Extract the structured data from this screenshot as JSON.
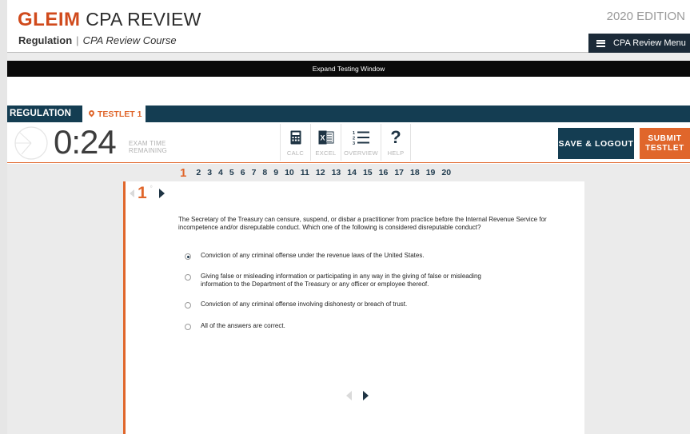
{
  "header": {
    "logo_brand": "GLEIM",
    "logo_rest": " CPA REVIEW",
    "subtitle_section": "Regulation",
    "subtitle_separator": "|",
    "subtitle_course": "CPA Review Course",
    "edition": "2020 EDITION",
    "menu_label": "CPA Review Menu"
  },
  "expand_bar": {
    "label": "Expand Testing Window"
  },
  "tabs": {
    "section": "REGULATION",
    "testlet": "TESTLET 1"
  },
  "toolbar": {
    "timer": "0:24",
    "timer_label_line1": "EXAM TIME",
    "timer_label_line2": "REMAINING",
    "tools": [
      {
        "label": "CALC",
        "icon": "calculator-icon"
      },
      {
        "label": "EXCEL",
        "icon": "excel-icon"
      },
      {
        "label": "OVERVIEW",
        "icon": "overview-list-icon"
      },
      {
        "label": "HELP",
        "icon": "help-icon"
      }
    ],
    "save_label": "SAVE & LOGOUT",
    "submit_line1": "SUBMIT",
    "submit_line2": "TESTLET"
  },
  "question_nav": {
    "current": 1,
    "items": [
      "1",
      "2",
      "3",
      "4",
      "5",
      "6",
      "7",
      "8",
      "9",
      "10",
      "11",
      "12",
      "13",
      "14",
      "15",
      "16",
      "17",
      "18",
      "19",
      "20"
    ]
  },
  "question": {
    "number": "1",
    "flag": "⁰",
    "text": "The Secretary of the Treasury can censure, suspend, or disbar a practitioner from practice before the Internal Revenue Service for incompetence and/or disreputable conduct. Which one of the following is considered disreputable conduct?",
    "answers": [
      {
        "text": "Conviction of any criminal offense under the revenue laws of the United States.",
        "selected": true
      },
      {
        "text": "Giving false or misleading information or participating in any way in the giving of false or misleading information to the Department of the Treasury or any officer or employee thereof.",
        "selected": false
      },
      {
        "text": "Conviction of any criminal offense involving dishonesty or breach of trust.",
        "selected": false
      },
      {
        "text": "All of the answers are correct.",
        "selected": false
      }
    ]
  },
  "colors": {
    "accent_orange": "#e0662b",
    "teal": "#143d52",
    "navy": "#1b2a38"
  }
}
